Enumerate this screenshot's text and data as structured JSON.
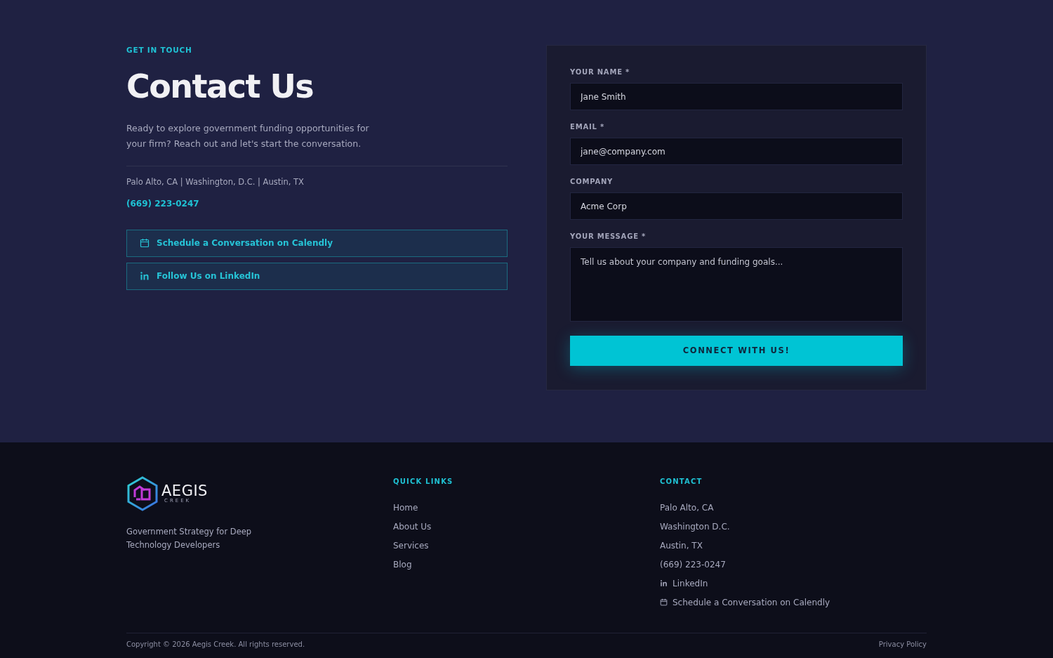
{
  "contact": {
    "eyebrow": "GET IN TOUCH",
    "title": "Contact Us",
    "intro": "Ready to explore government funding opportunities for your firm? Reach out and let's start the conversation.",
    "locations": "Palo Alto, CA | Washington, D.C. | Austin, TX",
    "phone": "(669) 223-0247",
    "actions": [
      {
        "kind": "calendar",
        "label": "Schedule a Conversation on Calendly"
      },
      {
        "kind": "linkedin",
        "label": "Follow Us on LinkedIn"
      }
    ]
  },
  "form": {
    "fields": [
      {
        "kind": "input",
        "label": "YOUR NAME *",
        "value": "Jane Smith"
      },
      {
        "kind": "input",
        "label": "EMAIL *",
        "value": "jane@company.com"
      },
      {
        "kind": "input",
        "label": "COMPANY",
        "value": "Acme Corp"
      },
      {
        "kind": "textarea",
        "label": "YOUR MESSAGE *",
        "placeholder": "Tell us about your company and funding goals..."
      }
    ],
    "submit": "CONNECT WITH US!"
  },
  "footer": {
    "logo": {
      "word": "AEGIS",
      "sub": "CREEK"
    },
    "tagline": "Government Strategy for Deep Technology Developers",
    "quick_links": {
      "heading": "QUICK LINKS",
      "items": [
        "Home",
        "About Us",
        "Services",
        "Blog"
      ]
    },
    "contact": {
      "heading": "CONTACT",
      "items": [
        {
          "kind": "text",
          "label": "Palo Alto, CA"
        },
        {
          "kind": "text",
          "label": "Washington D.C."
        },
        {
          "kind": "text",
          "label": "Austin, TX"
        },
        {
          "kind": "text",
          "label": "(669) 223-0247"
        },
        {
          "kind": "linkedin",
          "label": "LinkedIn"
        },
        {
          "kind": "calendar",
          "label": "Schedule a Conversation on Calendly"
        }
      ]
    },
    "copyright": "Copyright © 2026 Aegis Creek. All rights reserved.",
    "privacy": "Privacy Policy"
  }
}
